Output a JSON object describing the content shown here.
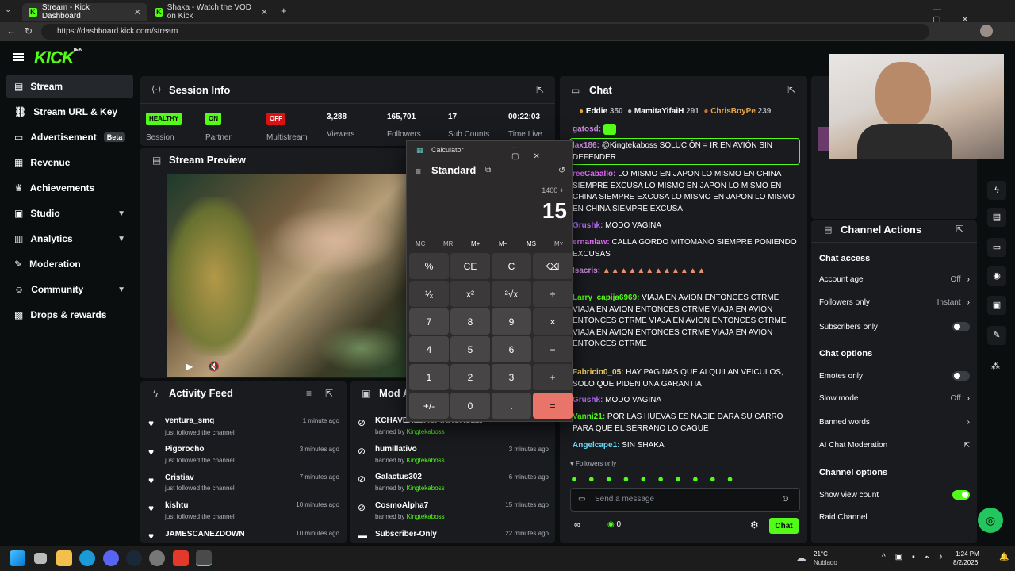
{
  "browser": {
    "tabs": [
      {
        "title": "Stream - Kick Dashboard"
      },
      {
        "title": "Shaka - Watch the VOD on Kick"
      }
    ],
    "url": "https://dashboard.kick.com/stream"
  },
  "brand": {
    "logo": "KICK",
    "beta": "BETA",
    "accent": "#53fc18"
  },
  "sidebar": {
    "items": [
      {
        "label": "Stream",
        "icon": "stream-icon"
      },
      {
        "label": "Stream URL & Key",
        "icon": "link-icon"
      },
      {
        "label": "Advertisement",
        "icon": "ad-icon",
        "badge": "Beta"
      },
      {
        "label": "Revenue",
        "icon": "chart-icon"
      },
      {
        "label": "Achievements",
        "icon": "trophy-icon"
      },
      {
        "label": "Studio",
        "icon": "grid-icon"
      },
      {
        "label": "Analytics",
        "icon": "bar-chart-icon"
      },
      {
        "label": "Moderation",
        "icon": "wrench-icon"
      },
      {
        "label": "Community",
        "icon": "community-icon"
      },
      {
        "label": "Drops & rewards",
        "icon": "gift-icon"
      }
    ]
  },
  "session": {
    "title": "Session Info",
    "stats": [
      {
        "value": "HEALTHY",
        "label": "Session"
      },
      {
        "value": "ON",
        "label": "Partner"
      },
      {
        "value": "OFF",
        "label": "Multistream"
      },
      {
        "value": "3,288",
        "label": "Viewers"
      },
      {
        "value": "165,701",
        "label": "Followers"
      },
      {
        "value": "17",
        "label": "Sub Counts"
      },
      {
        "value": "00:22:03",
        "label": "Time Live"
      }
    ]
  },
  "preview": {
    "title": "Stream Preview"
  },
  "activity": {
    "title": "Activity Feed",
    "items": [
      {
        "name": "ventura_smq",
        "sub": "just followed the channel",
        "time": "1 minute ago"
      },
      {
        "name": "Pigorocho",
        "sub": "just followed the channel",
        "time": "3 minutes ago"
      },
      {
        "name": "Cristiav",
        "sub": "just followed the channel",
        "time": "7 minutes ago"
      },
      {
        "name": "kishtu",
        "sub": "just followed the channel",
        "time": "10 minutes ago"
      },
      {
        "name": "JAMESCANEZDOWN",
        "sub": "",
        "time": "10 minutes ago"
      }
    ]
  },
  "mod": {
    "title": "Mod A",
    "items": [
      {
        "name": "KCHAVEREZASPIRACAS1212",
        "by": "Kingtekaboss",
        "time": ""
      },
      {
        "name": "humillativo",
        "by": "Kingtekaboss",
        "time": "3 minutes ago"
      },
      {
        "name": "Galactus302",
        "by": "Kingtekaboss",
        "time": "6 minutes ago"
      },
      {
        "name": "CosmoAlpha7",
        "by": "Kingtekaboss",
        "time": "15 minutes ago"
      },
      {
        "name": "Subscriber-Only",
        "by": "",
        "time": "22 minutes ago"
      }
    ],
    "banned_by": "banned by"
  },
  "chat": {
    "title": "Chat",
    "top": [
      {
        "name": "Eddie",
        "pts": "350"
      },
      {
        "name": "MamitaYifaiH",
        "pts": "291"
      },
      {
        "name": "ChrisBoyPe",
        "pts": "239"
      }
    ],
    "messages": [
      {
        "user": "gatosd:",
        "text": ""
      },
      {
        "user": "lax186:",
        "text": "@Kingtekaboss SOLUCIÓN = IR EN AVIÓN SIN DEFENDER"
      },
      {
        "user": "reeCaballo:",
        "text": "LO MISMO EN JAPON LO MISMO EN CHINA SIEMPRE EXCUSA LO MISMO EN JAPON LO MISMO EN CHINA SIEMPRE EXCUSA LO MISMO EN JAPON LO MISMO EN CHINA SIEMPRE EXCUSA"
      },
      {
        "user": "Grushk:",
        "text": "MODO VAGINA"
      },
      {
        "user": "ernanlaw:",
        "text": "CALLA GORDO MITOMANO SIEMPRE PONIENDO EXCUSAS"
      },
      {
        "user": "Isacris:",
        "text": ""
      },
      {
        "user": "Larry_capija6969:",
        "text": "VIAJA EN AVION ENTONCES CTRME VIAJA EN AVION ENTONCES CTRME VIAJA EN AVION ENTONCES CTRME VIAJA EN AVION ENTONCES CTRME VIAJA EN AVION ENTONCES CTRME VIAJA EN AVION ENTONCES CTRME"
      },
      {
        "user": "Fabricio0_05:",
        "text": "HAY PAGINAS QUE ALQUILAN VEICULOS, SOLO QUE PIDEN UNA GARANTIA"
      },
      {
        "user": "Grushk:",
        "text": "MODO VAGINA"
      },
      {
        "user": "Vanni21:",
        "text": "POR LAS HUEVAS ES NADIE DARA SU CARRO PARA QUE EL SERRANO LO CAGUE"
      },
      {
        "user": "Angelcape1:",
        "text": "SIN SHAKA"
      }
    ],
    "followers_only": "Followers only",
    "placeholder": "Send a message",
    "send": "Chat",
    "count": "0"
  },
  "calculator": {
    "title": "Calculator",
    "mode": "Standard",
    "expression": "1400 +",
    "display": "15",
    "memory": [
      "MC",
      "MR",
      "M+",
      "M−",
      "MS",
      "M˅"
    ],
    "keys": [
      [
        "%",
        "CE",
        "C",
        "⌫"
      ],
      [
        "¹⁄ₓ",
        "x²",
        "²√x",
        "÷"
      ],
      [
        "7",
        "8",
        "9",
        "×"
      ],
      [
        "4",
        "5",
        "6",
        "−"
      ],
      [
        "1",
        "2",
        "3",
        "+"
      ],
      [
        "+/-",
        "0",
        ".",
        "="
      ]
    ]
  },
  "channel": {
    "title": "Channel Actions",
    "chat_access": "Chat access",
    "rows": [
      {
        "label": "Account age",
        "value": "Off"
      },
      {
        "label": "Followers only",
        "value": "Instant"
      },
      {
        "label": "Subscribers only",
        "value": ""
      }
    ],
    "chat_options": "Chat options",
    "rows2": [
      {
        "label": "Emotes only",
        "value": ""
      },
      {
        "label": "Slow mode",
        "value": "Off"
      },
      {
        "label": "Banned words",
        "value": ""
      },
      {
        "label": "AI Chat Moderation",
        "value": ""
      }
    ],
    "channel_options": "Channel options",
    "rows3": [
      {
        "label": "Show view count",
        "value": ""
      },
      {
        "label": "Raid Channel",
        "value": ""
      }
    ]
  },
  "taskbar": {
    "temp": "21°C",
    "weather": "Nublado",
    "time": "1:24 PM",
    "date": "8/2/2026"
  }
}
